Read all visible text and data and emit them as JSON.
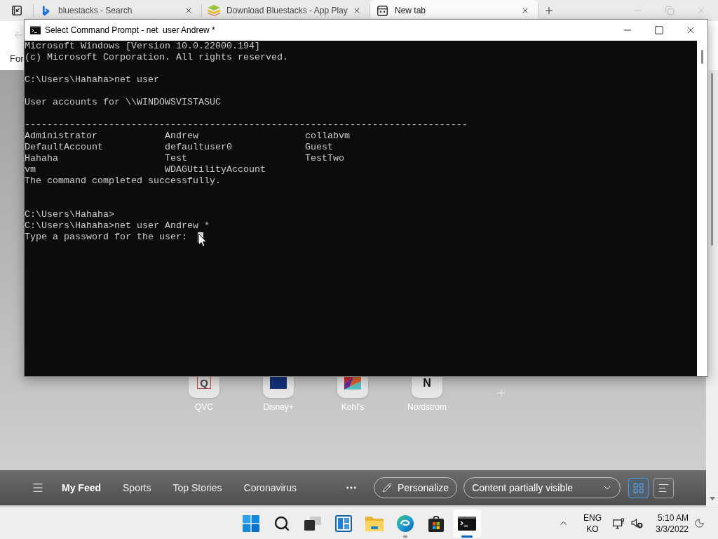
{
  "browser": {
    "tabs": [
      {
        "title": "bluestacks - Search",
        "kind": "b-logo",
        "selected": false
      },
      {
        "title": "Download Bluestacks - App Play",
        "kind": "layers",
        "selected": false
      },
      {
        "title": "New tab",
        "kind": "new-tab",
        "selected": true
      }
    ],
    "toolbar_text": "For",
    "shortcuts": [
      {
        "label": "QVC",
        "kind": "outlined-letter",
        "logo_text": "Q"
      },
      {
        "label": "Disney+",
        "kind": "block"
      },
      {
        "label": "Kohl's",
        "kind": "shapes"
      },
      {
        "label": "Nordstrom",
        "kind": "letter",
        "logo_text": "N"
      }
    ],
    "feed_bar": {
      "tabs": [
        {
          "label": "My Feed",
          "selected": true
        },
        {
          "label": "Sports",
          "selected": false
        },
        {
          "label": "Top Stories",
          "selected": false
        },
        {
          "label": "Coronavirus",
          "selected": false
        }
      ],
      "personalize": "Personalize",
      "visibility": "Content partially visible",
      "layouts": [
        {
          "kind": "grid",
          "selected": true
        },
        {
          "kind": "list",
          "selected": false
        }
      ]
    }
  },
  "console_window": {
    "title": "Select Command Prompt - net  user Andrew *",
    "lines": [
      {
        "kind": "text",
        "text": "Microsoft Windows [Version 10.0.22000.194]"
      },
      {
        "kind": "text",
        "text": "(c) Microsoft Corporation. All rights reserved."
      },
      {
        "kind": "blank"
      },
      {
        "kind": "text",
        "text": "C:\\Users\\Hahaha>net user"
      },
      {
        "kind": "blank"
      },
      {
        "kind": "text",
        "text": "User accounts for \\\\WINDOWSVISTASUC"
      },
      {
        "kind": "blank"
      },
      {
        "kind": "text",
        "text": "-------------------------------------------------------------------------------"
      },
      {
        "kind": "columns",
        "cells": [
          "Administrator",
          "Andrew",
          "collabvm"
        ]
      },
      {
        "kind": "columns",
        "cells": [
          "DefaultAccount",
          "defaultuser0",
          "Guest"
        ]
      },
      {
        "kind": "columns",
        "cells": [
          "Hahaha",
          "Test",
          "TestTwo"
        ]
      },
      {
        "kind": "columns",
        "cells": [
          "vm",
          "WDAGUtilityAccount"
        ]
      },
      {
        "kind": "text",
        "text": "The command completed successfully."
      },
      {
        "kind": "blank"
      },
      {
        "kind": "blank"
      },
      {
        "kind": "text",
        "text": "C:\\Users\\Hahaha>"
      },
      {
        "kind": "text",
        "text": "C:\\Users\\Hahaha>net user Andrew *"
      },
      {
        "kind": "input",
        "text": "Type a password for the user:",
        "cursor": true
      }
    ]
  },
  "taskbar": {
    "apps": [
      {
        "kind": "start",
        "running": false,
        "active": false
      },
      {
        "kind": "search",
        "running": false,
        "active": false
      },
      {
        "kind": "task-view",
        "running": false,
        "active": false
      },
      {
        "kind": "widgets",
        "running": false,
        "active": false
      },
      {
        "kind": "folder",
        "running": false,
        "active": false
      },
      {
        "kind": "browser",
        "running": true,
        "active": false
      },
      {
        "kind": "store",
        "running": false,
        "active": false
      },
      {
        "kind": "terminal",
        "running": true,
        "active": true
      }
    ],
    "language": [
      "ENG",
      "KO"
    ],
    "time": "5:10 AM",
    "date": "3/3/2022"
  }
}
